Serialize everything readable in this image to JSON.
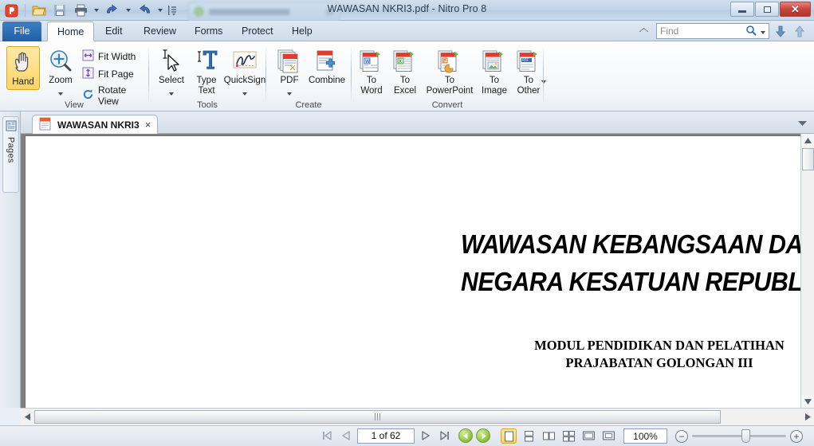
{
  "window": {
    "title": "WAWASAN NKRI3.pdf - Nitro Pro 8",
    "minimize_label": "Minimize",
    "restore_label": "Restore",
    "close_label": "Close"
  },
  "quick_access": {
    "items": [
      {
        "name": "nitro-logo-icon",
        "label": "Nitro Pro"
      },
      {
        "name": "open-icon",
        "label": "Open"
      },
      {
        "name": "save-icon",
        "label": "Save"
      },
      {
        "name": "print-icon",
        "label": "Print"
      },
      {
        "name": "undo-icon",
        "label": "Undo"
      },
      {
        "name": "redo-icon",
        "label": "Redo"
      },
      {
        "name": "customize-icon",
        "label": "Customize Quick Access Toolbar"
      }
    ]
  },
  "ribbon_tabs": [
    {
      "label": "File",
      "active": false
    },
    {
      "label": "Home",
      "active": true
    },
    {
      "label": "Edit",
      "active": false
    },
    {
      "label": "Review",
      "active": false
    },
    {
      "label": "Forms",
      "active": false
    },
    {
      "label": "Protect",
      "active": false
    },
    {
      "label": "Help",
      "active": false
    }
  ],
  "search": {
    "placeholder": "Find",
    "search_icon": "magnifier-icon",
    "dropdown_icon": "chevron-down-icon",
    "find_next_label": "Find Next",
    "find_previous_label": "Find Previous",
    "home_icon": "home-icon"
  },
  "ribbon": {
    "groups": [
      {
        "name": "view",
        "label": "View",
        "large_buttons": [
          {
            "label": "Hand",
            "icon": "hand-icon",
            "selected": true,
            "dropdown": false
          },
          {
            "label": "Zoom",
            "icon": "zoom-magnifier-plus-icon",
            "selected": false,
            "dropdown": true
          }
        ],
        "small_buttons": [
          {
            "label": "Fit Width",
            "icon": "fit-width-icon"
          },
          {
            "label": "Fit Page",
            "icon": "fit-page-icon"
          },
          {
            "label": "Rotate View",
            "icon": "rotate-view-icon"
          }
        ]
      },
      {
        "name": "tools",
        "label": "Tools",
        "large_buttons": [
          {
            "label": "Select",
            "icon": "select-cursor-icon",
            "selected": false,
            "dropdown": true
          },
          {
            "label": "Type\nText",
            "icon": "type-text-icon",
            "selected": false,
            "dropdown": false
          },
          {
            "label": "QuickSign",
            "icon": "quicksign-icon",
            "selected": false,
            "dropdown": true
          }
        ]
      },
      {
        "name": "create",
        "label": "Create",
        "large_buttons": [
          {
            "label": "PDF",
            "icon": "create-pdf-icon",
            "selected": false,
            "dropdown": true
          },
          {
            "label": "Combine",
            "icon": "combine-icon",
            "selected": false,
            "dropdown": false
          }
        ]
      },
      {
        "name": "convert",
        "label": "Convert",
        "large_buttons": [
          {
            "label": "To\nWord",
            "icon": "to-word-icon",
            "selected": false,
            "dropdown": false
          },
          {
            "label": "To\nExcel",
            "icon": "to-excel-icon",
            "selected": false,
            "dropdown": false
          },
          {
            "label": "To\nPowerPoint",
            "icon": "to-powerpoint-icon",
            "selected": false,
            "dropdown": false
          },
          {
            "label": "To\nImage",
            "icon": "to-image-icon",
            "selected": false,
            "dropdown": false
          },
          {
            "label": "To\nOther",
            "icon": "to-other-icon",
            "selected": false,
            "dropdown": true
          }
        ]
      }
    ]
  },
  "document_tab": {
    "label": "WAWASAN NKRI3",
    "close_label": "×",
    "file_icon": "pdf-file-icon",
    "collapse_icon": "chevron-down-icon"
  },
  "sidebar": {
    "pages_label": "Pages",
    "pages_icon": "pages-thumbnail-icon"
  },
  "document": {
    "title_line1": "WAWASAN KEBANGSAAN DALAM KERANGK",
    "title_line2": "NEGARA KESATUAN REPUBLIK INDONESIA",
    "subtitle_line1": "MODUL PENDIDIKAN DAN PELATIHAN",
    "subtitle_line2": "PRAJABATAN GOLONGAN III"
  },
  "status_bar": {
    "page_value": "1 of 62",
    "first_page_label": "First Page",
    "previous_page_label": "Previous Page",
    "next_page_label": "Next Page",
    "last_page_label": "Last Page",
    "go_back_label": "Previous View",
    "go_forward_label": "Next View",
    "zoom_value": "100%",
    "zoom_out_label": "−",
    "zoom_in_label": "+",
    "view_modes": [
      {
        "name": "single-page",
        "label": "Single Page",
        "selected": true
      },
      {
        "name": "continuous",
        "label": "Continuous",
        "selected": false
      },
      {
        "name": "facing",
        "label": "Facing",
        "selected": false
      },
      {
        "name": "facing-continuous",
        "label": "Facing Continuous",
        "selected": false
      },
      {
        "name": "full-screen",
        "label": "Full Screen",
        "selected": false
      },
      {
        "name": "reader-view",
        "label": "Reader View",
        "selected": false
      }
    ]
  },
  "colors": {
    "accent": "#1e5fa8",
    "selection": "#ffd466",
    "close_red": "#c9453b",
    "title_text": "#2b3b4d"
  }
}
